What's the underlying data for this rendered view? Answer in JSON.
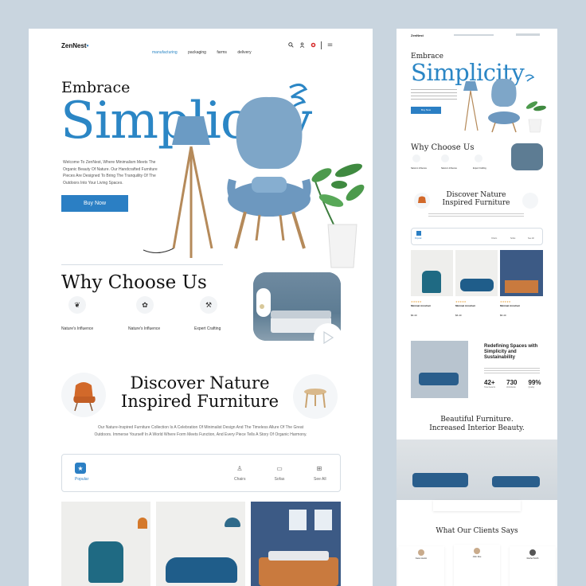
{
  "left": {
    "brand": "ZenNest",
    "nav": [
      "manufacturing",
      "packaging",
      "farms",
      "delivery"
    ],
    "hero": {
      "title_small": "Embrace",
      "title_big": "Simplicity",
      "body": "Welcome To ZenNest, Where Minimalism Meets The Organic Beauty Of Nature. Our Handcrafted Furniture Pieces Are Designed To Bring The Tranquility Of The Outdoors Into Your Living Spaces.",
      "cta": "Buy Now"
    },
    "why": {
      "title": "Why Choose Us",
      "features": [
        "Nature's Influence",
        "Nature's Influence",
        "Expert Crafting"
      ]
    },
    "discover": {
      "title_line1": "Discover Nature",
      "title_line2": "Inspired Furniture",
      "body": "Our Nature-Inspired Furniture Collection Is A Celebration Of Minimalist Design And The Timeless Allure Of The Great Outdoors. Immerse Yourself In A World Where Form Meets Function, And Every Piece Tells A Story Of Organic Harmony."
    },
    "tabs": [
      "Popular",
      "Chairs",
      "Sofas",
      "See All"
    ]
  },
  "right": {
    "brand": "ZenNest",
    "hero_small": "Embrace",
    "hero_big": "Simplicity",
    "cta": "Buy Now",
    "why_title": "Why Choose Us",
    "features": [
      "Nature's Influence",
      "Nature's Influence",
      "Expert Crafting"
    ],
    "discover_line1": "Discover Nature",
    "discover_line2": "Inspired Furniture",
    "tabs": [
      "Popular",
      "Chairs",
      "Sofas",
      "See All"
    ],
    "products": [
      {
        "name": "Minimal Armchair",
        "price": "$6.40"
      },
      {
        "name": "Minimal Armchair",
        "price": "$6.40"
      },
      {
        "name": "Minimal Armchair",
        "price": "$6.40"
      }
    ],
    "redefine_title": "Redefining Spaces with Simplicity and Sustainability",
    "stats": [
      {
        "value": "42+",
        "label": "Total Awards"
      },
      {
        "value": "730",
        "label": "Worldwide"
      },
      {
        "value": "99%",
        "label": "Quality"
      }
    ],
    "beauty_line1": "Beautiful Furniture.",
    "beauty_line2": "Increased Interior Beauty.",
    "clients_title": "What Our Clients Says",
    "clients": [
      "Karen Austin",
      "John Doe",
      "Rachel Smith"
    ]
  },
  "colors": {
    "accent": "#2b7fc4",
    "background": "#c9d5df",
    "chair_blue": "#7ea6c8",
    "wall_slate": "#5d7c93"
  }
}
